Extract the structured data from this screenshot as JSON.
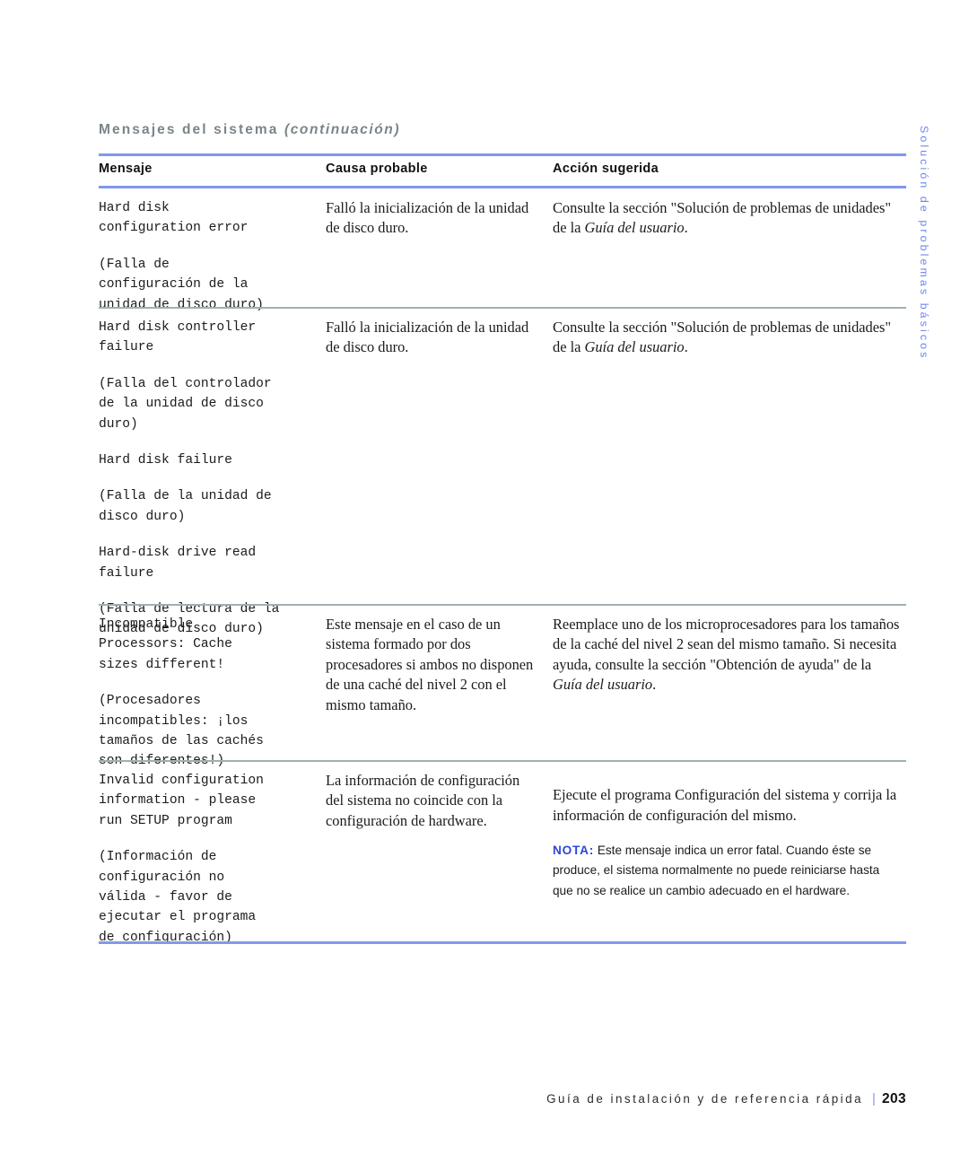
{
  "section": {
    "title": "Mensajes del sistema",
    "continued": "(continuación)"
  },
  "colors": {
    "rule_blue": "#8098ef",
    "rule_gray": "#9fb0b2",
    "title_gray": "#7b8589",
    "sidetab_blue": "#6b86e8",
    "note_blue": "#2b47d8"
  },
  "table": {
    "headers": {
      "message": "Mensaje",
      "cause": "Causa probable",
      "action": "Acción sugerida"
    },
    "rows": [
      {
        "message_en": "Hard disk\nconfiguration error",
        "message_es": "(Falla de\nconfiguración de la\nunidad de disco duro)",
        "cause": "Falló la inicialización de la unidad de disco duro.",
        "action_pre": "Consulte la sección \"Solución de problemas de unidades\" de la ",
        "action_italic": "Guía del usuario",
        "action_post": "."
      },
      {
        "message_en": "Hard disk controller\nfailure",
        "message_es": "(Falla del controlador\nde la unidad de disco\nduro)",
        "message_en2": "Hard disk failure",
        "message_es2": "(Falla de la unidad de\ndisco duro)",
        "message_en3": "Hard-disk drive read\nfailure",
        "message_es3": "(Falla de lectura de la\nunidad de disco duro)",
        "cause": "Falló la inicialización de la unidad de disco duro.",
        "action_pre": "Consulte la sección \"Solución de problemas de unidades\" de la ",
        "action_italic": "Guía del usuario",
        "action_post": "."
      },
      {
        "message_en": "Incompatible\nProcessors: Cache\nsizes different!",
        "message_es": "(Procesadores\nincompatibles: ¡los\ntamaños de las cachés\nson diferentes!)",
        "cause": "Este mensaje en el caso de un sistema formado por dos procesadores si ambos no disponen de una caché del nivel 2 con el mismo tamaño.",
        "action_pre": "Reemplace uno de los microprocesadores para los tamaños de la caché del nivel 2 sean del mismo tamaño. Si necesita ayuda, consulte la sección \"Obtención de ayuda\" de la ",
        "action_italic": "Guía del usuario",
        "action_post": "."
      },
      {
        "message_en": "Invalid configuration\ninformation - please\nrun SETUP program",
        "message_es": "(Información de\nconfiguración no\nválida - favor de\nejecutar el programa\nde configuración)",
        "cause": "La información de configuración del sistema no coincide con la configuración de hardware.",
        "action_pre": "Ejecute el programa Configuración del sistema y corrija la información de configuración del mismo.",
        "note_label": "NOTA:",
        "note_text": "Este mensaje indica un error fatal. Cuando éste se produce, el sistema normalmente no puede reiniciarse hasta que no se realice un cambio adecuado en el hardware."
      }
    ]
  },
  "sidetab": {
    "label": "Solución de problemas básicos"
  },
  "footer": {
    "text": "Guía de instalación y de referencia rápida",
    "separator": "|",
    "page": "203"
  }
}
